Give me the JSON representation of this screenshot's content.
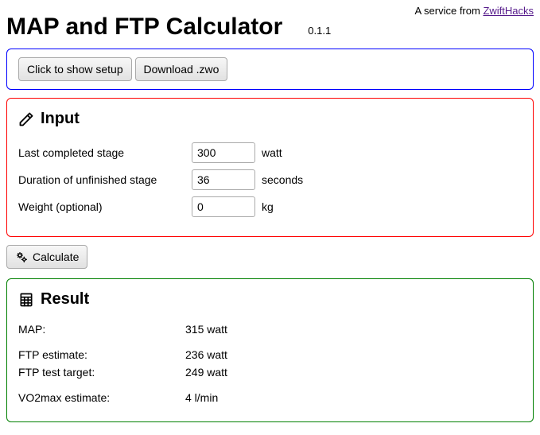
{
  "topline": {
    "prefix": "A service from ",
    "link": "ZwiftHacks"
  },
  "title": "MAP and FTP Calculator",
  "version": "0.1.1",
  "setup": {
    "show_setup": "Click to show setup",
    "download": "Download .zwo"
  },
  "input": {
    "heading": "Input",
    "stage_label": "Last completed stage",
    "stage_value": "300",
    "stage_unit": "watt",
    "duration_label": "Duration of unfinished stage",
    "duration_value": "36",
    "duration_unit": "seconds",
    "weight_label": "Weight (optional)",
    "weight_value": "0",
    "weight_unit": "kg"
  },
  "calculate_label": "Calculate",
  "result": {
    "heading": "Result",
    "map_label": "MAP:",
    "map_value": "315 watt",
    "ftp_est_label": "FTP estimate:",
    "ftp_est_value": "236 watt",
    "ftp_target_label": "FTP test target:",
    "ftp_target_value": "249 watt",
    "vo2_label": "VO2max estimate:",
    "vo2_value": "4 l/min"
  }
}
